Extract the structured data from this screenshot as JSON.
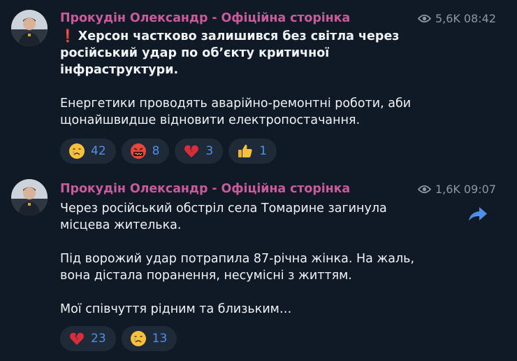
{
  "posts": [
    {
      "channel_name": "Прокудін Олександр - Офіційна сторінка",
      "views": "5,6K",
      "time": "08:42",
      "alert_glyph": "❗",
      "headline": "Херсон частково залишився без світла через російський удар по об’єкту критичної інфраструктури.",
      "paragraphs": [
        "Енергетики проводять аварійно-ремонтні роботи, аби щонайшвидше відновити електропостачання."
      ],
      "reactions": [
        {
          "icon": "crying-face-icon",
          "count": "42"
        },
        {
          "icon": "face-with-symbols-icon",
          "count": "8"
        },
        {
          "icon": "broken-heart-icon",
          "count": "3"
        },
        {
          "icon": "thumbs-up-icon",
          "count": "1"
        }
      ]
    },
    {
      "channel_name": "Прокудін Олександр - Офіційна сторінка",
      "views": "1,6K",
      "time": "09:07",
      "paragraphs": [
        "Через російський обстріл села Томарине загинула місцева жителька.",
        "Під ворожий удар потрапила 87-річна жінка. На жаль, вона дістала поранення, несумісні з життям.",
        "Мої співчуття рідним та близьким…"
      ],
      "reactions": [
        {
          "icon": "broken-heart-icon",
          "count": "23"
        },
        {
          "icon": "crying-face-icon",
          "count": "13"
        }
      ]
    }
  ],
  "colors": {
    "background": "#101a26",
    "channel_name": "#c85b9b",
    "meta": "#8e98a5",
    "reaction_bg": "#1f2a38",
    "reaction_count": "#4f8fe8",
    "share_icon": "#4f8fe8",
    "alert": "#e53935"
  }
}
